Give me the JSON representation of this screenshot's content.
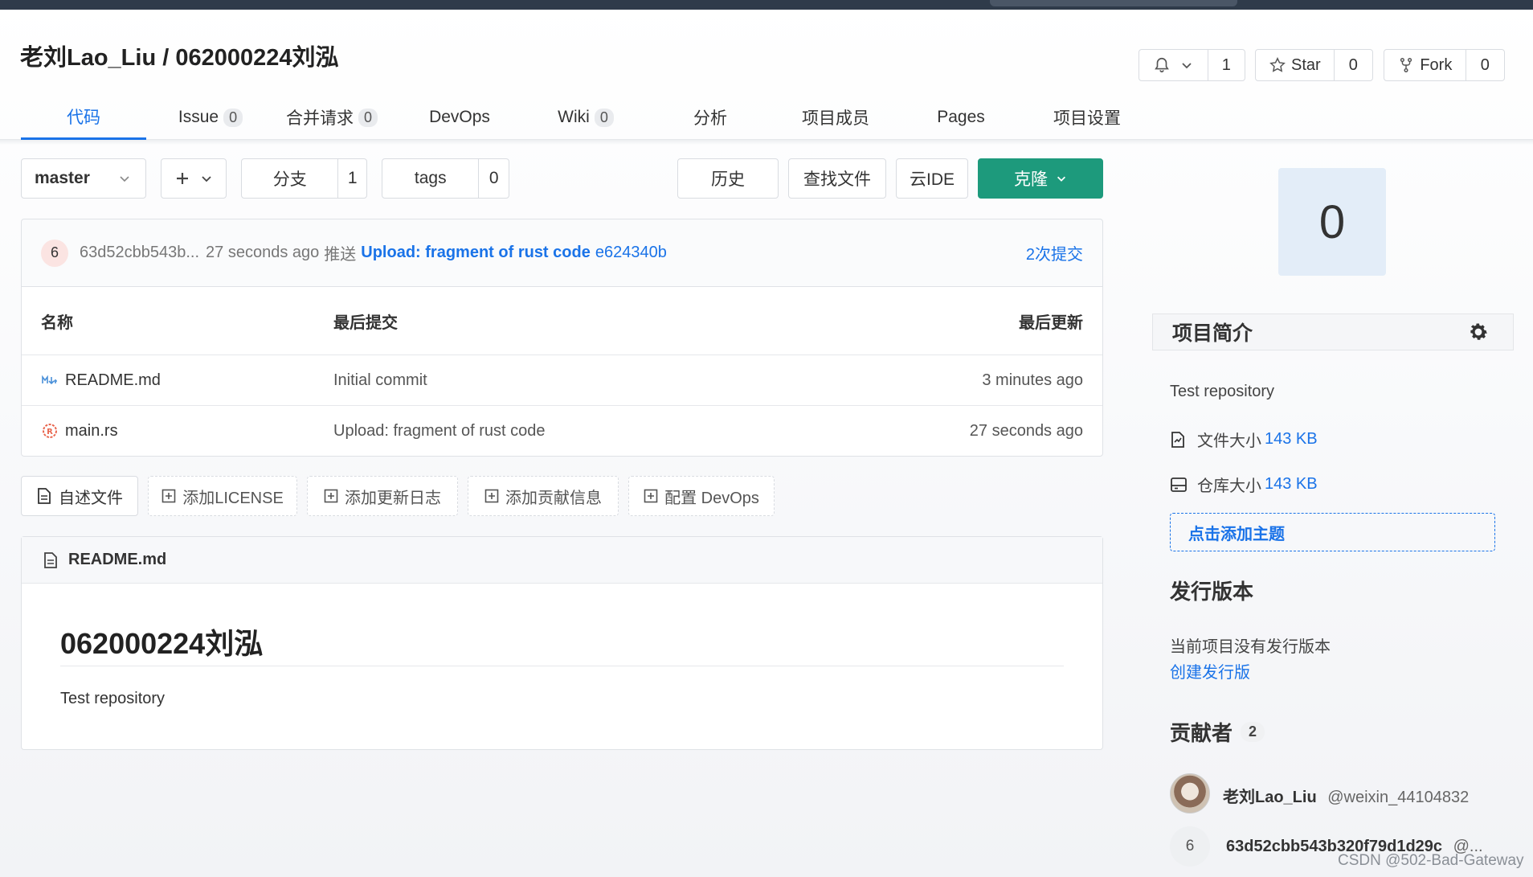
{
  "repo": {
    "owner": "老刘Lao_Liu",
    "separator": "/",
    "name": "062000224刘泓"
  },
  "social": {
    "watch_count": "1",
    "star_label": "Star",
    "star_count": "0",
    "fork_label": "Fork",
    "fork_count": "0"
  },
  "tabs": [
    {
      "label": "代码"
    },
    {
      "label": "Issue",
      "count": "0"
    },
    {
      "label": "合并请求",
      "count": "0"
    },
    {
      "label": "DevOps"
    },
    {
      "label": "Wiki",
      "count": "0"
    },
    {
      "label": "分析"
    },
    {
      "label": "项目成员"
    },
    {
      "label": "Pages"
    },
    {
      "label": "项目设置"
    }
  ],
  "toolbar": {
    "branch": "master",
    "branches_label": "分支",
    "branches_count": "1",
    "tags_label": "tags",
    "tags_count": "0",
    "history": "历史",
    "find_file": "查找文件",
    "cloud_ide": "云IDE",
    "clone": "克隆"
  },
  "commit": {
    "avatar": "6",
    "author": "63d52cbb543b...",
    "time": "27 seconds ago",
    "action": "推送",
    "message": "Upload: fragment of rust code",
    "hash": "e624340b",
    "count_label": "2次提交"
  },
  "files": {
    "headers": {
      "name": "名称",
      "commit": "最后提交",
      "updated": "最后更新"
    },
    "rows": [
      {
        "name": "README.md",
        "icon": "markdown-icon",
        "commit": "Initial commit",
        "updated": "3 minutes ago"
      },
      {
        "name": "main.rs",
        "icon": "rust-icon",
        "commit": "Upload: fragment of rust code",
        "updated": "27 seconds ago"
      }
    ]
  },
  "readme_buttons": [
    "自述文件",
    "添加LICENSE",
    "添加更新日志",
    "添加贡献信息",
    "配置 DevOps"
  ],
  "readme": {
    "filename": "README.md",
    "heading": "062000224刘泓",
    "text": "Test repository"
  },
  "sidebar": {
    "big_number": "0",
    "intro_title": "项目简介",
    "description": "Test repository",
    "file_size_label": "文件大小",
    "file_size": "143 KB",
    "repo_size_label": "仓库大小",
    "repo_size": "143 KB",
    "add_topic": "点击添加主题",
    "release_title": "发行版本",
    "no_release": "当前项目没有发行版本",
    "create_release": "创建发行版",
    "contributors_title": "贡献者",
    "contributors_count": "2",
    "contributors": [
      {
        "name": "老刘Lao_Liu",
        "handle": "@weixin_44104832"
      },
      {
        "avatar": "6",
        "name": "63d52cbb543b320f79d1d29c",
        "handle": "@..."
      }
    ]
  },
  "watermark": "CSDN @502-Bad-Gateway",
  "colors": {
    "accent": "#1a73e8",
    "primary": "#1d9a7c",
    "count_bg": "#e3edf8"
  }
}
